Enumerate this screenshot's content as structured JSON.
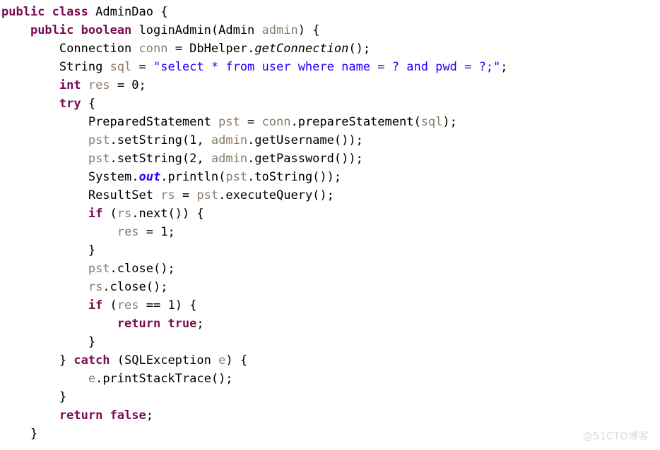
{
  "editor": {
    "language": "java",
    "background_color": "#ffffff",
    "font_size_px": 17,
    "line_height_px": 26,
    "theme_colors": {
      "keyword": "#7a0a52",
      "string": "#2a00ff",
      "variable": "#8c7b6b",
      "type": "#000000",
      "number": "#000000",
      "static_field": "#2a00ff",
      "static_method": "#000000"
    }
  },
  "watermark": {
    "text": "@51CTO博客",
    "color": "#d9d9d9"
  },
  "code": {
    "full_text": "public class AdminDao {\n    public boolean loginAdmin(Admin admin) {\n        Connection conn = DbHelper.getConnection();\n        String sql = \"select * from user where name = ? and pwd = ?;\";\n        int res = 0;\n        try {\n            PreparedStatement pst = conn.prepareStatement(sql);\n            pst.setString(1, admin.getUsername());\n            pst.setString(2, admin.getPassword());\n            System.out.println(pst.toString());\n            ResultSet rs = pst.executeQuery();\n            if (rs.next()) {\n                res = 1;\n            }\n            pst.close();\n            rs.close();\n            if (res == 1) {\n                return true;\n            }\n        } catch (SQLException e) {\n            e.printStackTrace();\n        }\n        return false;\n    }",
    "lines": [
      {
        "n": 1,
        "text": "public class AdminDao {",
        "tokens": [
          {
            "t": "public",
            "k": "kw"
          },
          {
            "t": " ",
            "k": "plain"
          },
          {
            "t": "class",
            "k": "kw"
          },
          {
            "t": " ",
            "k": "plain"
          },
          {
            "t": "AdminDao",
            "k": "type"
          },
          {
            "t": " {",
            "k": "punct"
          }
        ]
      },
      {
        "n": 2,
        "text": "    public boolean loginAdmin(Admin admin) {",
        "tokens": [
          {
            "t": "    ",
            "k": "plain"
          },
          {
            "t": "public",
            "k": "kw"
          },
          {
            "t": " ",
            "k": "plain"
          },
          {
            "t": "boolean",
            "k": "kw"
          },
          {
            "t": " loginAdmin(",
            "k": "plain"
          },
          {
            "t": "Admin",
            "k": "type"
          },
          {
            "t": " ",
            "k": "plain"
          },
          {
            "t": "admin",
            "k": "var"
          },
          {
            "t": ") {",
            "k": "punct"
          }
        ]
      },
      {
        "n": 3,
        "text": "        Connection conn = DbHelper.getConnection();",
        "tokens": [
          {
            "t": "        ",
            "k": "plain"
          },
          {
            "t": "Connection",
            "k": "type"
          },
          {
            "t": " ",
            "k": "plain"
          },
          {
            "t": "conn",
            "k": "var"
          },
          {
            "t": " = ",
            "k": "plain"
          },
          {
            "t": "DbHelper",
            "k": "type"
          },
          {
            "t": ".",
            "k": "punct"
          },
          {
            "t": "getConnection",
            "k": "static"
          },
          {
            "t": "();",
            "k": "punct"
          }
        ]
      },
      {
        "n": 4,
        "text": "        String sql = \"select * from user where name = ? and pwd = ?;\";",
        "tokens": [
          {
            "t": "        ",
            "k": "plain"
          },
          {
            "t": "String",
            "k": "type"
          },
          {
            "t": " ",
            "k": "plain"
          },
          {
            "t": "sql",
            "k": "var"
          },
          {
            "t": " = ",
            "k": "plain"
          },
          {
            "t": "\"select * from user where name = ? and pwd = ?;\"",
            "k": "str"
          },
          {
            "t": ";",
            "k": "punct"
          }
        ]
      },
      {
        "n": 5,
        "text": "        int res = 0;",
        "tokens": [
          {
            "t": "        ",
            "k": "plain"
          },
          {
            "t": "int",
            "k": "kw"
          },
          {
            "t": " ",
            "k": "plain"
          },
          {
            "t": "res",
            "k": "var"
          },
          {
            "t": " = ",
            "k": "plain"
          },
          {
            "t": "0",
            "k": "num"
          },
          {
            "t": ";",
            "k": "punct"
          }
        ]
      },
      {
        "n": 6,
        "text": "        try {",
        "tokens": [
          {
            "t": "        ",
            "k": "plain"
          },
          {
            "t": "try",
            "k": "kw"
          },
          {
            "t": " {",
            "k": "punct"
          }
        ]
      },
      {
        "n": 7,
        "text": "            PreparedStatement pst = conn.prepareStatement(sql);",
        "tokens": [
          {
            "t": "            ",
            "k": "plain"
          },
          {
            "t": "PreparedStatement",
            "k": "type"
          },
          {
            "t": " ",
            "k": "plain"
          },
          {
            "t": "pst",
            "k": "var"
          },
          {
            "t": " = ",
            "k": "plain"
          },
          {
            "t": "conn",
            "k": "var"
          },
          {
            "t": ".prepareStatement(",
            "k": "plain"
          },
          {
            "t": "sql",
            "k": "var"
          },
          {
            "t": ");",
            "k": "punct"
          }
        ]
      },
      {
        "n": 8,
        "text": "            pst.setString(1, admin.getUsername());",
        "tokens": [
          {
            "t": "            ",
            "k": "plain"
          },
          {
            "t": "pst",
            "k": "var"
          },
          {
            "t": ".setString(",
            "k": "plain"
          },
          {
            "t": "1",
            "k": "num"
          },
          {
            "t": ", ",
            "k": "plain"
          },
          {
            "t": "admin",
            "k": "var"
          },
          {
            "t": ".getUsername());",
            "k": "plain"
          }
        ]
      },
      {
        "n": 9,
        "text": "            pst.setString(2, admin.getPassword());",
        "tokens": [
          {
            "t": "            ",
            "k": "plain"
          },
          {
            "t": "pst",
            "k": "var"
          },
          {
            "t": ".setString(",
            "k": "plain"
          },
          {
            "t": "2",
            "k": "num"
          },
          {
            "t": ", ",
            "k": "plain"
          },
          {
            "t": "admin",
            "k": "var"
          },
          {
            "t": ".getPassword());",
            "k": "plain"
          }
        ]
      },
      {
        "n": 10,
        "text": "            System.out.println(pst.toString());",
        "tokens": [
          {
            "t": "            ",
            "k": "plain"
          },
          {
            "t": "System",
            "k": "type"
          },
          {
            "t": ".",
            "k": "punct"
          },
          {
            "t": "out",
            "k": "staticf"
          },
          {
            "t": ".println(",
            "k": "plain"
          },
          {
            "t": "pst",
            "k": "var"
          },
          {
            "t": ".toString());",
            "k": "plain"
          }
        ]
      },
      {
        "n": 11,
        "text": "            ResultSet rs = pst.executeQuery();",
        "tokens": [
          {
            "t": "            ",
            "k": "plain"
          },
          {
            "t": "ResultSet",
            "k": "type"
          },
          {
            "t": " ",
            "k": "plain"
          },
          {
            "t": "rs",
            "k": "var"
          },
          {
            "t": " = ",
            "k": "plain"
          },
          {
            "t": "pst",
            "k": "var"
          },
          {
            "t": ".executeQuery();",
            "k": "plain"
          }
        ]
      },
      {
        "n": 12,
        "text": "            if (rs.next()) {",
        "tokens": [
          {
            "t": "            ",
            "k": "plain"
          },
          {
            "t": "if",
            "k": "kw"
          },
          {
            "t": " (",
            "k": "punct"
          },
          {
            "t": "rs",
            "k": "var"
          },
          {
            "t": ".next()) {",
            "k": "plain"
          }
        ]
      },
      {
        "n": 13,
        "text": "                res = 1;",
        "tokens": [
          {
            "t": "                ",
            "k": "plain"
          },
          {
            "t": "res",
            "k": "var"
          },
          {
            "t": " = ",
            "k": "plain"
          },
          {
            "t": "1",
            "k": "num"
          },
          {
            "t": ";",
            "k": "punct"
          }
        ]
      },
      {
        "n": 14,
        "text": "            }",
        "tokens": [
          {
            "t": "            ",
            "k": "plain"
          },
          {
            "t": "}",
            "k": "punct"
          }
        ]
      },
      {
        "n": 15,
        "text": "            pst.close();",
        "tokens": [
          {
            "t": "            ",
            "k": "plain"
          },
          {
            "t": "pst",
            "k": "var"
          },
          {
            "t": ".close();",
            "k": "plain"
          }
        ]
      },
      {
        "n": 16,
        "text": "            rs.close();",
        "tokens": [
          {
            "t": "            ",
            "k": "plain"
          },
          {
            "t": "rs",
            "k": "var"
          },
          {
            "t": ".close();",
            "k": "plain"
          }
        ]
      },
      {
        "n": 17,
        "text": "            if (res == 1) {",
        "tokens": [
          {
            "t": "            ",
            "k": "plain"
          },
          {
            "t": "if",
            "k": "kw"
          },
          {
            "t": " (",
            "k": "punct"
          },
          {
            "t": "res",
            "k": "var"
          },
          {
            "t": " == ",
            "k": "plain"
          },
          {
            "t": "1",
            "k": "num"
          },
          {
            "t": ") {",
            "k": "punct"
          }
        ]
      },
      {
        "n": 18,
        "text": "                return true;",
        "tokens": [
          {
            "t": "                ",
            "k": "plain"
          },
          {
            "t": "return",
            "k": "kw"
          },
          {
            "t": " ",
            "k": "plain"
          },
          {
            "t": "true",
            "k": "kw"
          },
          {
            "t": ";",
            "k": "punct"
          }
        ]
      },
      {
        "n": 19,
        "text": "            }",
        "tokens": [
          {
            "t": "            ",
            "k": "plain"
          },
          {
            "t": "}",
            "k": "punct"
          }
        ]
      },
      {
        "n": 20,
        "text": "        } catch (SQLException e) {",
        "tokens": [
          {
            "t": "        } ",
            "k": "punct"
          },
          {
            "t": "catch",
            "k": "kw"
          },
          {
            "t": " (",
            "k": "punct"
          },
          {
            "t": "SQLException",
            "k": "type"
          },
          {
            "t": " ",
            "k": "plain"
          },
          {
            "t": "e",
            "k": "var"
          },
          {
            "t": ") {",
            "k": "punct"
          }
        ]
      },
      {
        "n": 21,
        "text": "            e.printStackTrace();",
        "tokens": [
          {
            "t": "            ",
            "k": "plain"
          },
          {
            "t": "e",
            "k": "var"
          },
          {
            "t": ".printStackTrace();",
            "k": "plain"
          }
        ]
      },
      {
        "n": 22,
        "text": "        }",
        "tokens": [
          {
            "t": "        ",
            "k": "plain"
          },
          {
            "t": "}",
            "k": "punct"
          }
        ]
      },
      {
        "n": 23,
        "text": "        return false;",
        "tokens": [
          {
            "t": "        ",
            "k": "plain"
          },
          {
            "t": "return",
            "k": "kw"
          },
          {
            "t": " ",
            "k": "plain"
          },
          {
            "t": "false",
            "k": "kw"
          },
          {
            "t": ";",
            "k": "punct"
          }
        ]
      },
      {
        "n": 24,
        "text": "    }",
        "tokens": [
          {
            "t": "    ",
            "k": "plain"
          },
          {
            "t": "}",
            "k": "punct"
          }
        ]
      }
    ]
  }
}
